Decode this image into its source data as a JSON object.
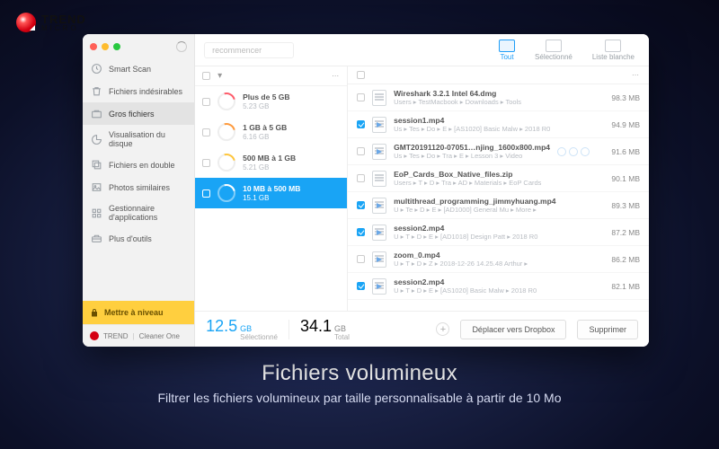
{
  "brand": {
    "line1": "TREND",
    "line2": "MICRO"
  },
  "hero": {
    "title": "Fichiers volumineux",
    "subtitle": "Filtrer les fichiers volumineux par taille personnalisable à partir de 10 Mo"
  },
  "sidebar": {
    "items": [
      {
        "label": "Smart Scan",
        "icon": "clock-icon"
      },
      {
        "label": "Fichiers indésirables",
        "icon": "trash-icon"
      },
      {
        "label": "Gros fichiers",
        "icon": "briefcase-icon",
        "active": true
      },
      {
        "label": "Visualisation du disque",
        "icon": "pie-icon"
      },
      {
        "label": "Fichiers en double",
        "icon": "copies-icon"
      },
      {
        "label": "Photos similaires",
        "icon": "image-icon"
      },
      {
        "label": "Gestionnaire d'applications",
        "icon": "grid-icon"
      },
      {
        "label": "Plus d'outils",
        "icon": "toolbox-icon"
      }
    ],
    "upgrade": "Mettre à niveau",
    "brandbar": {
      "a": "TREND",
      "b": "Cleaner One"
    }
  },
  "topbar": {
    "search_placeholder": "recommencer",
    "tabs": [
      {
        "label": "Tout",
        "active": true
      },
      {
        "label": "Sélectionné"
      },
      {
        "label": "Liste blanche"
      }
    ]
  },
  "buckets_header": {
    "sort_glyph": "▾",
    "menu_glyph": "⋯"
  },
  "buckets": [
    {
      "label": "Plus de 5 GB",
      "sub": "5.23 GB",
      "color": "#ff5b6a"
    },
    {
      "label": "1 GB à 5 GB",
      "sub": "6.16 GB",
      "color": "#ff9a3c"
    },
    {
      "label": "500 MB à 1 GB",
      "sub": "5.21 GB",
      "color": "#ffc63b"
    },
    {
      "label": "10 MB à 500 MB",
      "sub": "15.1 GB",
      "color": "#19a4f5",
      "active": true
    }
  ],
  "files_header": {
    "menu_glyph": "⋯"
  },
  "files": [
    {
      "name": "Wireshark 3.2.1 Intel 64.dmg",
      "path": "Users ▸ TestMacbook ▸ Downloads ▸ Tools",
      "size": "98.3 MB",
      "checked": false,
      "kind": "doc"
    },
    {
      "name": "session1.mp4",
      "path": "Us ▸ Tes ▸ Do ▸ E ▸ [AS1020] Basic Malw ▸ 2018 R0",
      "size": "94.9 MB",
      "checked": true,
      "kind": "vid"
    },
    {
      "name": "GMT20191120-07051…njing_1600x800.mp4",
      "path": "Us ▸ Tes ▸ Do ▸ Tra ▸ E ▸ Lesson 3 ▸ Video",
      "size": "91.6 MB",
      "checked": false,
      "kind": "vid",
      "extra_icons": true
    },
    {
      "name": "EoP_Cards_Box_Native_files.zip",
      "path": "Users ▸ T ▸ D ▸ Tra ▸ AD ▸ Materials ▸ EoP Cards",
      "size": "90.1 MB",
      "checked": false,
      "kind": "doc"
    },
    {
      "name": "multithread_programming_jimmyhuang.mp4",
      "path": "U ▸ Te ▸ D ▸ E ▸ [AD1000] General Mu ▸ More ▸",
      "size": "89.3 MB",
      "checked": true,
      "kind": "vid"
    },
    {
      "name": "session2.mp4",
      "path": "U ▸ T ▸ D ▸ E ▸ [AD1018] Design Patt ▸ 2018 R0",
      "size": "87.2 MB",
      "checked": true,
      "kind": "vid"
    },
    {
      "name": "zoom_0.mp4",
      "path": "U ▸ T ▸ D ▸ Z ▸ 2018-12-26 14.25.48 Arthur ▸",
      "size": "86.2 MB",
      "checked": false,
      "kind": "vid"
    },
    {
      "name": "session2.mp4",
      "path": "U ▸ T ▸ D ▸ E ▸ [AS1020] Basic Malw ▸ 2018 R0",
      "size": "82.1 MB",
      "checked": true,
      "kind": "vid"
    }
  ],
  "footer": {
    "selected": {
      "value": "12.5",
      "unit": "GB",
      "label": "Sélectionné"
    },
    "total": {
      "value": "34.1",
      "unit": "GB",
      "label": "Total"
    },
    "dropbox_btn": "Déplacer vers Dropbox",
    "delete_btn": "Supprimer"
  }
}
